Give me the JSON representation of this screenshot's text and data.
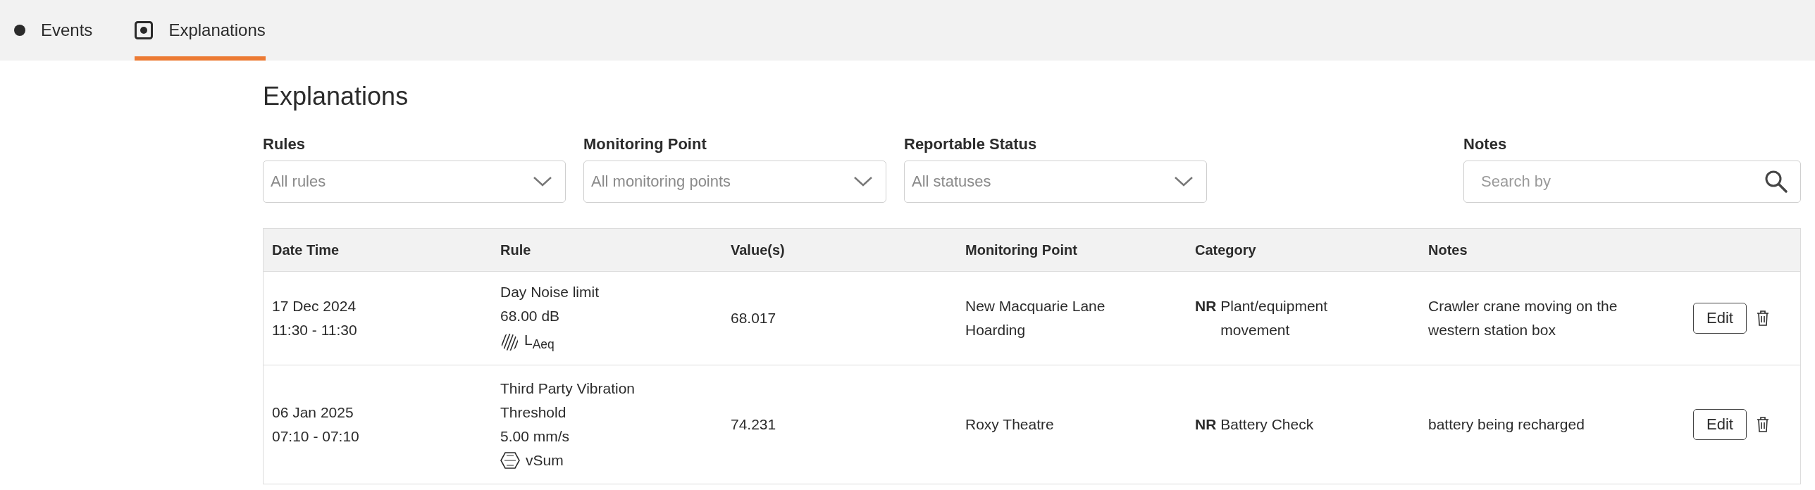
{
  "tabs": [
    {
      "label": "Events",
      "kind": "dot",
      "selected": false
    },
    {
      "label": "Explanations",
      "kind": "boxed-dot",
      "selected": true
    }
  ],
  "page_title": "Explanations",
  "filters": [
    {
      "label": "Rules",
      "placeholder": "All rules",
      "kind": "select"
    },
    {
      "label": "Monitoring Point",
      "placeholder": "All monitoring points",
      "kind": "select"
    },
    {
      "label": "Reportable Status",
      "placeholder": "All statuses",
      "kind": "select"
    },
    {
      "label": "Notes",
      "placeholder": "Search by",
      "kind": "search"
    }
  ],
  "table": {
    "columns": [
      "Date Time",
      "Rule",
      "Value(s)",
      "Monitoring Point",
      "Category",
      "Notes"
    ],
    "rows": [
      {
        "date": "17 Dec 2024",
        "time": "11:30 - 11:30",
        "rule_lines": [
          "Day Noise limit",
          "68.00 dB"
        ],
        "metric": {
          "kind": "noise",
          "label": "L$_{Aeq}$"
        },
        "value": "68.017",
        "monitoring_point": "New Macquarie Lane Hoarding",
        "category_code": "NR",
        "category": "Plant/equipment movement",
        "notes": "Crawler crane moving on the western station box",
        "action": "Edit"
      },
      {
        "date": "06 Jan 2025",
        "time": "07:10 - 07:10",
        "rule_lines": [
          "Third Party Vibration Threshold",
          "5.00 mm/s"
        ],
        "metric": {
          "kind": "vibration",
          "label": "vSum"
        },
        "value": "74.231",
        "monitoring_point": "Roxy Theatre",
        "category_code": "NR",
        "category": "Battery Check",
        "notes": "battery being recharged",
        "action": "Edit"
      }
    ]
  }
}
